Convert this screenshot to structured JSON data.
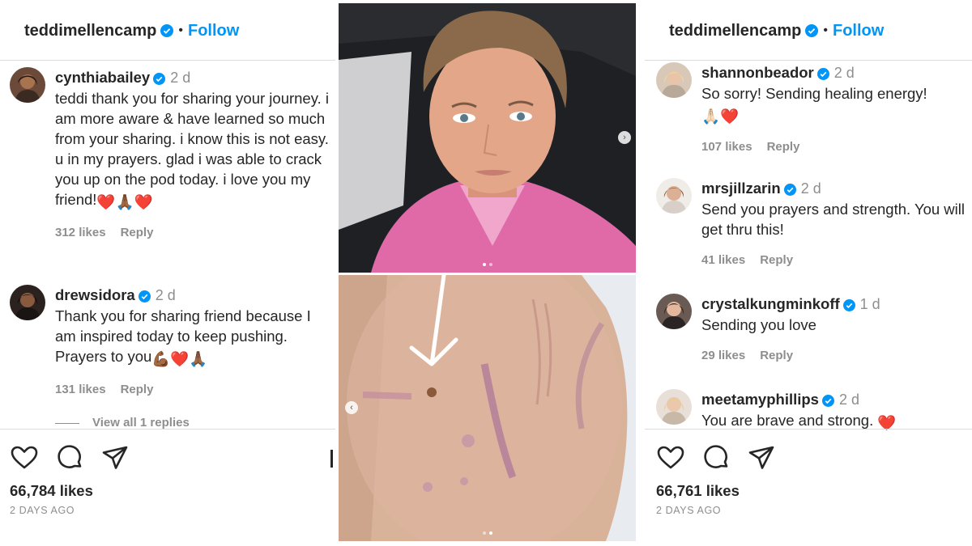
{
  "left_post": {
    "username": "teddimellencamp",
    "follow_label": "Follow",
    "comments": [
      {
        "username": "cynthiabailey",
        "time": "2 d",
        "text": "teddi thank you for sharing your journey. i am more aware & have learned so much from your sharing. i know this is not easy. u in my prayers. glad i was able to crack you up on the pod today. i love you my friend!",
        "emoji": "❤️🙏🏾❤️",
        "likes": "312 likes",
        "reply": "Reply"
      },
      {
        "username": "drewsidora",
        "time": "2 d",
        "text": "Thank you for sharing friend because I am inspired today to keep pushing. Prayers to you",
        "emoji": "💪🏾❤️🙏🏾",
        "likes": "131 likes",
        "reply": "Reply"
      }
    ],
    "view_replies": "View all 1 replies",
    "like_count": "66,784 likes",
    "posted": "2 DAYS AGO"
  },
  "right_post": {
    "username": "teddimellencamp",
    "follow_label": "Follow",
    "comments": [
      {
        "username": "shannonbeador",
        "time": "2 d",
        "text": "So sorry! Sending healing energy!",
        "emoji": "🙏🏻❤️",
        "likes": "107 likes",
        "reply": "Reply"
      },
      {
        "username": "mrsjillzarin",
        "time": "2 d",
        "text": "Send you prayers and strength. You will get thru this!",
        "likes": "41 likes",
        "reply": "Reply"
      },
      {
        "username": "crystalkungminkoff",
        "time": "1 d",
        "text": "Sending you love",
        "likes": "29 likes",
        "reply": "Reply"
      },
      {
        "username": "meetamyphillips",
        "time": "2 d",
        "text": "You are brave and strong.",
        "emoji": "❤️"
      }
    ],
    "like_count": "66,761 likes",
    "posted": "2 DAYS AGO"
  },
  "icons": {
    "verified": "verified-badge-icon",
    "like": "heart-icon",
    "comment": "comment-bubble-icon",
    "share": "paper-plane-icon"
  },
  "colors": {
    "accent": "#0095f6",
    "muted": "#8e8e8e",
    "text": "#262626",
    "heart_red": "#e0245e"
  }
}
